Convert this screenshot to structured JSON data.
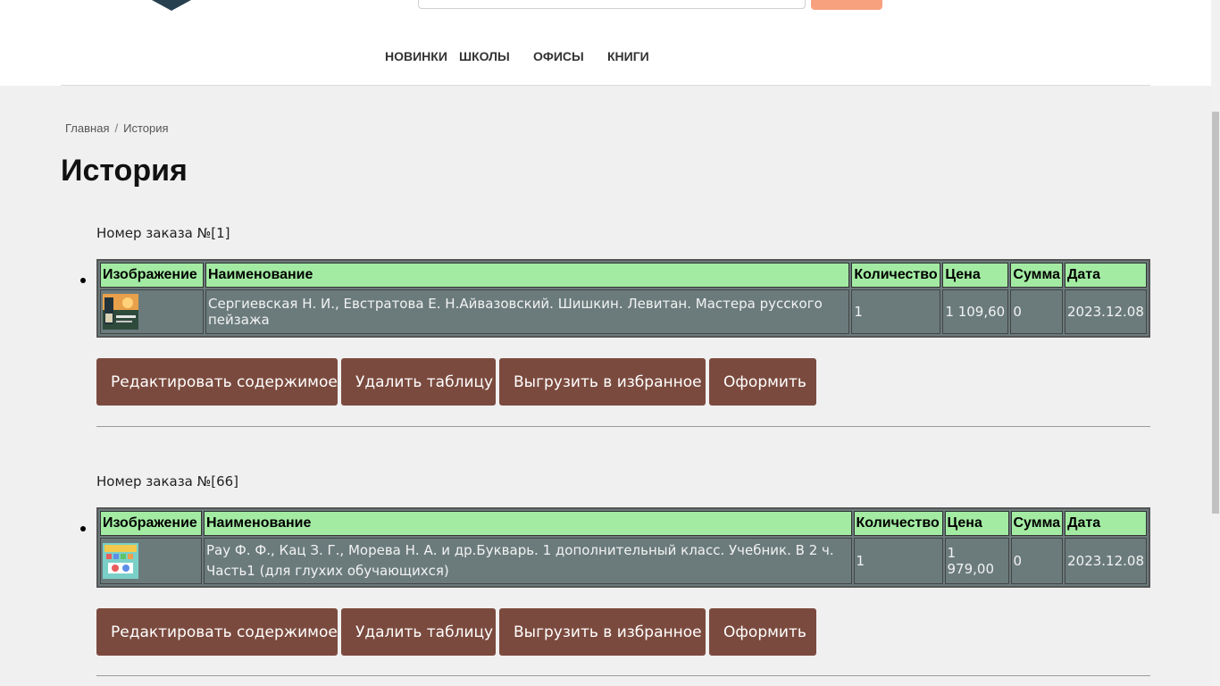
{
  "nav": {
    "items": [
      {
        "label": "НОВИНКИ"
      },
      {
        "label": "ШКОЛЫ"
      },
      {
        "label": "ОФИСЫ"
      },
      {
        "label": "КНИГИ"
      }
    ]
  },
  "breadcrumb": {
    "home": "Главная",
    "separator": "/",
    "current": "История"
  },
  "page_title": "История",
  "table_headers": [
    "Изображение",
    "Наименование",
    "Количество",
    "Цена",
    "Сумма",
    "Дата"
  ],
  "orders": [
    {
      "label": "Номер заказа №[1]",
      "rows": [
        {
          "image": "book-cover-landscape-painting",
          "name": "Сергиевская Н. И., Евстратова Е. Н.Айвазовский. Шишкин. Левитан. Мастера русского пейзажа",
          "quantity": "1",
          "price": "1 109,60",
          "sum": "0",
          "date": "2023.12.08"
        }
      ]
    },
    {
      "label": "Номер заказа №[66]",
      "rows": [
        {
          "image": "book-cover-primer",
          "name": "Рау Ф. Ф., Кац З. Г., Морева Н. А. и др.Букварь. 1 дополнительный класс. Учебник. В 2 ч. Часть1 (для глухих обучающихся)",
          "quantity": "1",
          "price": "1 979,00",
          "sum": "0",
          "date": "2023.12.08"
        }
      ]
    }
  ],
  "buttons": {
    "edit": "Редактировать содержимое",
    "delete": "Удалить таблицу",
    "export": "Выгрузить в избранное",
    "checkout": "Оформить"
  },
  "colors": {
    "header_row": "#a3eba3",
    "table_body": "#6b7b7c",
    "button": "#7b4a3e",
    "search_button": "#f7a17f",
    "logo": "#27404f"
  }
}
